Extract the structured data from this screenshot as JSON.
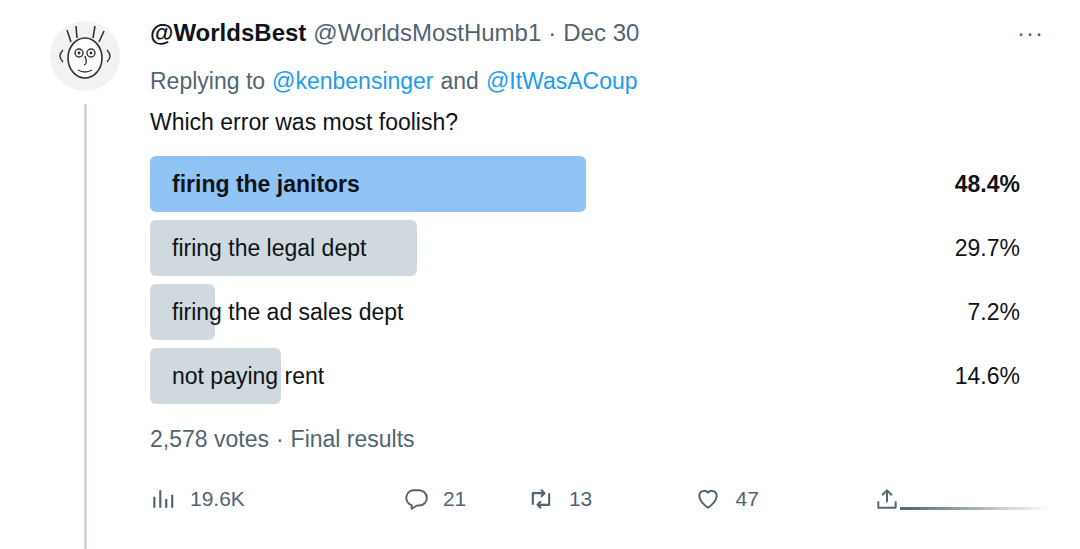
{
  "author": {
    "name": "@WorldsBest",
    "handle": "@WorldsMostHumb1",
    "separator": "·",
    "date": "Dec 30"
  },
  "more_button": "···",
  "reply_context": {
    "prefix": "Replying to",
    "mentions": [
      "@kenbensinger",
      "@ItWasACoup"
    ],
    "conjunction": "and"
  },
  "text": "Which error was most foolish?",
  "poll": {
    "options": [
      {
        "label": "firing the janitors",
        "percent": "48.4%",
        "level": 0.484,
        "selected": true
      },
      {
        "label": "firing the legal dept",
        "percent": "29.7%",
        "level": 0.297,
        "selected": false
      },
      {
        "label": "firing the ad sales dept",
        "percent": "7.2%",
        "level": 0.072,
        "selected": false
      },
      {
        "label": "not paying rent",
        "percent": "14.6%",
        "level": 0.146,
        "selected": false
      }
    ],
    "votes": "2,578 votes",
    "separator": "·",
    "status": "Final results"
  },
  "actions": [
    {
      "kind": "views",
      "count": "19.6K"
    },
    {
      "kind": "reply",
      "count": "21"
    },
    {
      "kind": "retweet",
      "count": "13"
    },
    {
      "kind": "like",
      "count": "47"
    },
    {
      "kind": "share",
      "count": ""
    }
  ]
}
